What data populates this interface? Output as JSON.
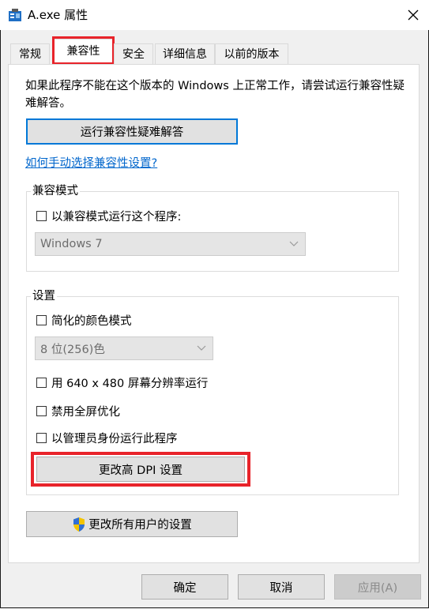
{
  "window": {
    "title": "A.exe 属性",
    "close_icon": "close-icon",
    "app_icon": "properties-icon"
  },
  "tabs": [
    {
      "label": "常规"
    },
    {
      "label": "兼容性"
    },
    {
      "label": "安全"
    },
    {
      "label": "详细信息"
    },
    {
      "label": "以前的版本"
    }
  ],
  "compat": {
    "intro": "如果此程序不能在这个版本的 Windows 上正常工作，请尝试运行兼容性疑难解答。",
    "run_troubleshooter": "运行兼容性疑难解答",
    "manual_link": "如何手动选择兼容性设置?",
    "mode_group": {
      "title": "兼容模式",
      "checkbox_label": "以兼容模式运行这个程序:",
      "os_select_value": "Windows 7"
    },
    "settings_group": {
      "title": "设置",
      "reduced_color": "简化的颜色模式",
      "color_select_value": "8 位(256)色",
      "res_640": "用 640 x 480 屏幕分辨率运行",
      "disable_fullscreen": "禁用全屏优化",
      "run_as_admin": "以管理员身份运行此程序",
      "change_dpi": "更改高 DPI 设置"
    },
    "all_users": "更改所有用户的设置"
  },
  "footer": {
    "ok": "确定",
    "cancel": "取消",
    "apply": "应用(A)"
  },
  "colors": {
    "highlight_red": "#e8232a",
    "link_blue": "#0066cc",
    "focus_blue": "#0078d7"
  }
}
